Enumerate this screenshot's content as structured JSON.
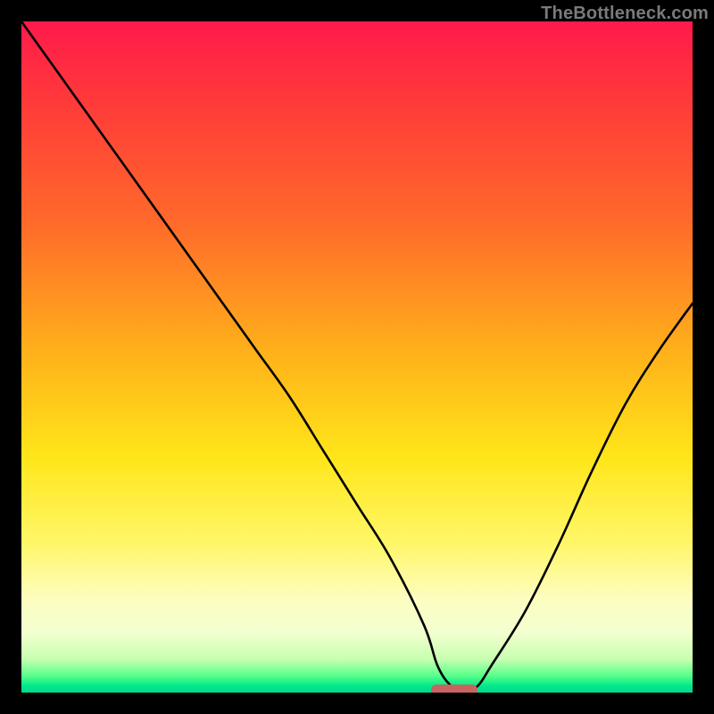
{
  "watermark": {
    "text": "TheBottleneck.com"
  },
  "chart_data": {
    "type": "line",
    "title": "",
    "xlabel": "",
    "ylabel": "",
    "xlim": [
      0,
      100
    ],
    "ylim": [
      0,
      100
    ],
    "grid": false,
    "legend": null,
    "gradient_colors": {
      "top": "#ff1a4b",
      "mid_high": "#ffb31a",
      "mid_low": "#fff76a",
      "bottom": "#00d98c"
    },
    "series": [
      {
        "name": "bottleneck-curve",
        "x": [
          0,
          5,
          10,
          15,
          20,
          25,
          30,
          35,
          40,
          45,
          50,
          55,
          60,
          62,
          64,
          66,
          68,
          70,
          75,
          80,
          85,
          90,
          95,
          100
        ],
        "y": [
          100,
          93,
          86,
          79,
          72,
          65,
          58,
          51,
          44,
          36,
          28,
          20,
          10,
          4,
          1,
          0,
          1,
          4,
          12,
          22,
          33,
          43,
          51,
          58
        ]
      }
    ],
    "marker": {
      "name": "optimal-range",
      "x_start": 61,
      "x_end": 68,
      "y": 0,
      "color": "#c96460"
    }
  }
}
